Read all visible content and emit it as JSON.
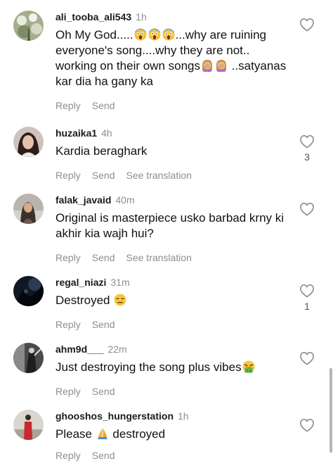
{
  "comments": [
    {
      "username": "ali_tooba_ali543",
      "time": "1h",
      "text_parts": [
        "Oh My God.....",
        "...why are ruining everyone's song....why they are not.. working on their own songs",
        " ..satyanas kar dia ha gany ka"
      ],
      "reply_label": "Reply",
      "send_label": "Send",
      "likes": ""
    },
    {
      "username": "huzaika1",
      "time": "4h",
      "text": "Kardia beraghark",
      "reply_label": "Reply",
      "send_label": "Send",
      "translate_label": "See translation",
      "likes": "3"
    },
    {
      "username": "falak_javaid",
      "time": "40m",
      "text": "Original is masterpiece usko barbad krny ki akhir kia wajh hui?",
      "reply_label": "Reply",
      "send_label": "Send",
      "translate_label": "See translation",
      "likes": ""
    },
    {
      "username": "regal_niazi",
      "time": "31m",
      "text": "Destroyed ",
      "reply_label": "Reply",
      "send_label": "Send",
      "likes": "1"
    },
    {
      "username": "ahm9d___",
      "time": "22m",
      "text": "Just destroying the song plus vibes",
      "reply_label": "Reply",
      "send_label": "Send",
      "likes": ""
    },
    {
      "username": "ghooshos_hungerstation",
      "time": "1h",
      "text_parts": [
        "Please ",
        " destroyed"
      ],
      "reply_label": "Reply",
      "send_label": "Send",
      "likes": ""
    }
  ],
  "icons": {
    "like": "heart-outline-icon",
    "emoji_scream": "face-screaming-in-fear-emoji",
    "emoji_facepalm": "woman-facepalming-emoji",
    "emoji_expressionless": "expressionless-face-emoji",
    "emoji_nauseated": "face-vomiting-emoji",
    "emoji_pray": "folded-hands-emoji"
  },
  "colors": {
    "text": "#111111",
    "muted": "#8e8e8e",
    "background": "#ffffff"
  }
}
